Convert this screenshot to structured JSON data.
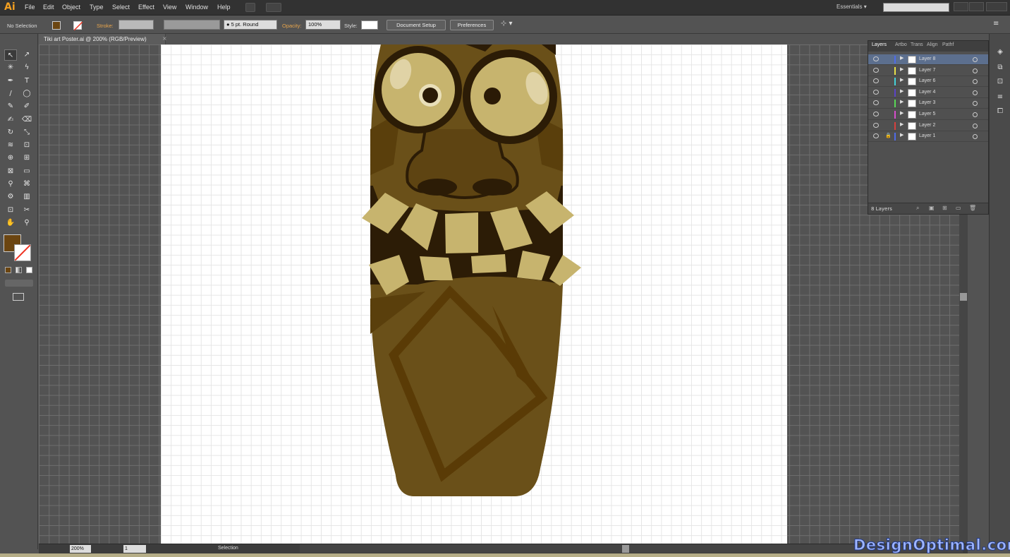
{
  "app": {
    "logo": "Ai",
    "accent": "#f3a021"
  },
  "menu": {
    "items": [
      "File",
      "Edit",
      "Object",
      "Type",
      "Select",
      "Effect",
      "View",
      "Window",
      "Help"
    ]
  },
  "workspace": {
    "label": "Essentials",
    "search_placeholder": ""
  },
  "control": {
    "selection_label": "No Selection",
    "fill_color": "#6b4511",
    "stroke_label": "Stroke:",
    "brush_label": "5 pt. Round",
    "opacity_label": "Opacity:",
    "opacity_value": "100%",
    "style_label": "Style:",
    "document_setup": "Document Setup",
    "preferences": "Preferences"
  },
  "document": {
    "tab_title": "Tiki art Poster.ai @ 200% (RGB/Preview)"
  },
  "tools": {
    "icons": [
      "selection-icon",
      "direct-selection-icon",
      "magic-wand-icon",
      "lasso-icon",
      "pen-icon",
      "type-icon",
      "line-icon",
      "ellipse-icon",
      "paintbrush-icon",
      "pencil-icon",
      "blob-brush-icon",
      "eraser-icon",
      "rotate-icon",
      "scale-icon",
      "width-icon",
      "free-transform-icon",
      "shape-builder-icon",
      "perspective-grid-icon",
      "mesh-icon",
      "gradient-icon",
      "eyedropper-icon",
      "blend-icon",
      "symbol-sprayer-icon",
      "column-graph-icon",
      "artboard-icon",
      "slice-icon",
      "hand-icon",
      "zoom-icon"
    ],
    "glyphs": [
      "↖",
      "↗",
      "✳",
      "ϟ",
      "✒",
      "T",
      "/",
      "◯",
      "✎",
      "✐",
      "✍",
      "⌫",
      "↻",
      "⤡",
      "≋",
      "⊡",
      "⊕",
      "⊞",
      "⊠",
      "▭",
      "⚲",
      "⌘",
      "⚙",
      "▥",
      "⊡",
      "✂",
      "✋",
      "⚲"
    ]
  },
  "layers_panel": {
    "tabs": [
      "Layers",
      "Artbo",
      "Trans",
      "Align",
      "Pathf"
    ],
    "layers": [
      {
        "name": "Layer 8",
        "color": "#4f6be8",
        "selected": true
      },
      {
        "name": "Layer 7",
        "color": "#e8e049"
      },
      {
        "name": "Layer 6",
        "color": "#45d2d8"
      },
      {
        "name": "Layer 4",
        "color": "#5c43c8"
      },
      {
        "name": "Layer 3",
        "color": "#59d855"
      },
      {
        "name": "Layer 5",
        "color": "#d84ccd"
      },
      {
        "name": "Layer 2",
        "color": "#d8403e"
      },
      {
        "name": "Layer 1",
        "color": "#4f6be8",
        "locked": true
      }
    ],
    "count_label": "8 Layers"
  },
  "status": {
    "zoom": "200%",
    "artboard": "1",
    "tool": "Selection"
  },
  "colors": {
    "tiki_base": "#6a5019",
    "tiki_dark": "#2c1c06",
    "tiki_light": "#c7b46e",
    "pupil": "#2a1a06"
  },
  "watermark": "DesignOptimal.com"
}
